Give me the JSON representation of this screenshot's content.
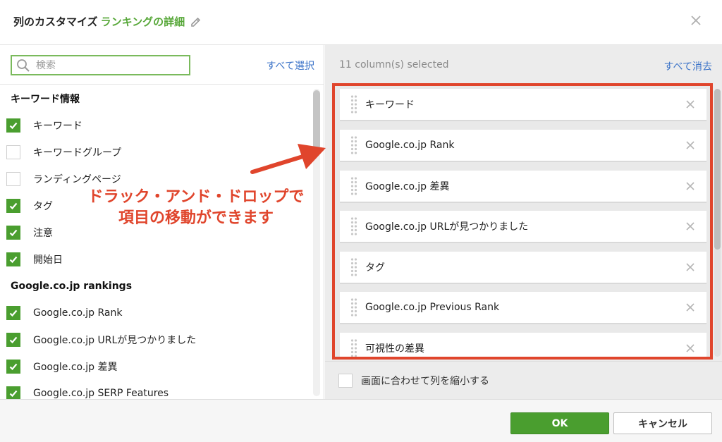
{
  "header": {
    "title": "列のカスタマイズ",
    "subtitle": "ランキングの詳細",
    "icon": "pencil-icon",
    "close_icon": "close-icon"
  },
  "left": {
    "search_placeholder": "検索",
    "select_all": "すべて選択",
    "groups": [
      {
        "title": "キーワード情報",
        "items": [
          {
            "label": "キーワード",
            "checked": true
          },
          {
            "label": "キーワードグループ",
            "checked": false
          },
          {
            "label": "ランディングページ",
            "checked": false
          },
          {
            "label": "タグ",
            "checked": true
          },
          {
            "label": "注意",
            "checked": true
          },
          {
            "label": "開始日",
            "checked": true
          }
        ]
      },
      {
        "title": "Google.co.jp rankings",
        "items": [
          {
            "label": "Google.co.jp Rank",
            "checked": true
          },
          {
            "label": "Google.co.jp URLが見つかりました",
            "checked": true
          },
          {
            "label": "Google.co.jp 差異",
            "checked": true
          },
          {
            "label": "Google.co.jp SERP Features",
            "checked": true
          }
        ]
      }
    ]
  },
  "right": {
    "selected_count": "11 column(s) selected",
    "clear_all": "すべて消去",
    "columns": [
      "キーワード",
      "Google.co.jp Rank",
      "Google.co.jp 差異",
      "Google.co.jp URLが見つかりました",
      "タグ",
      "Google.co.jp Previous Rank",
      "可視性の差異"
    ],
    "shrink_label": "画面に合わせて列を縮小する",
    "shrink_checked": false
  },
  "annotation": {
    "line1": "ドラック・アンド・ドロップで",
    "line2": "項目の移動ができます",
    "color": "#e0452c"
  },
  "footer": {
    "ok": "OK",
    "cancel": "キャンセル"
  },
  "colors": {
    "accent_green": "#58a83a",
    "checkbox_green": "#4a9e2f",
    "link_blue": "#3b73c8",
    "highlight_red": "#e0452c"
  }
}
